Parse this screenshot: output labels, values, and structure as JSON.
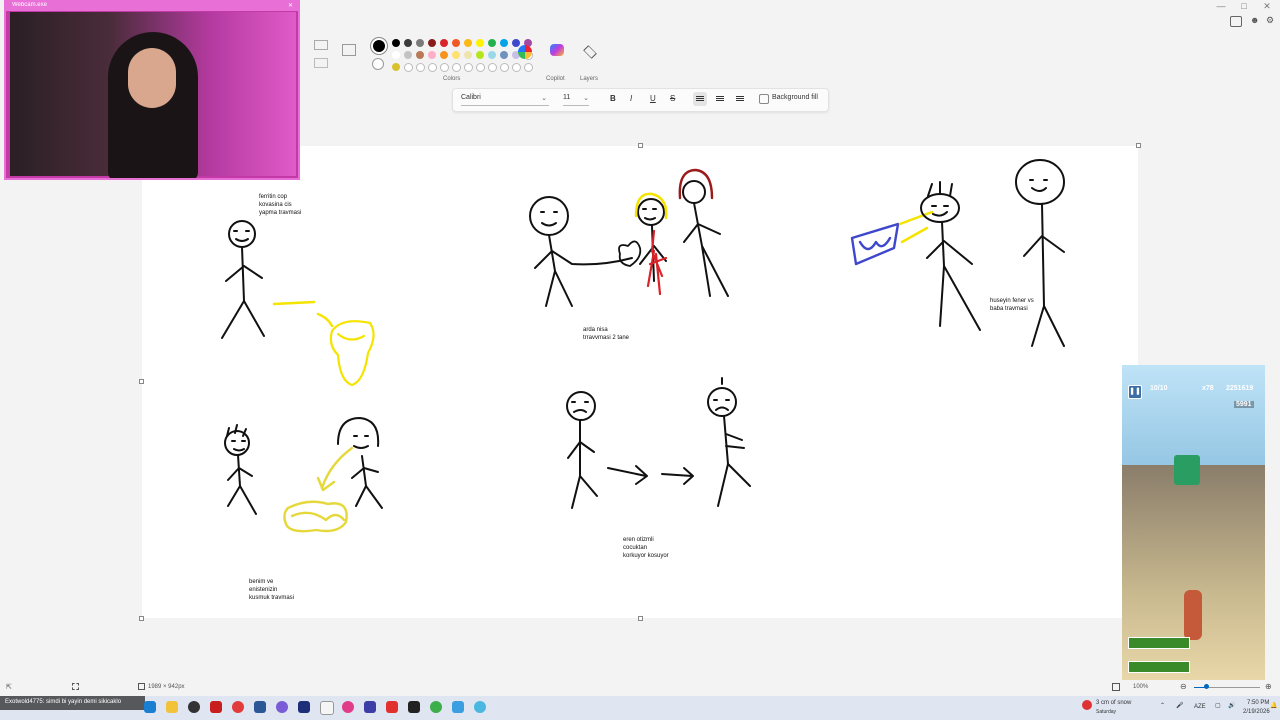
{
  "webcam": {
    "title": "Webcam.exe"
  },
  "ribbon": {
    "colors_label": "Colors",
    "copilot_label": "Copilot",
    "layers_label": "Layers",
    "palette_row1": [
      "#000000",
      "#3b3b3b",
      "#7a7a7a",
      "#8b1c1c",
      "#d8232a",
      "#f15a24",
      "#fdb813",
      "#fff200",
      "#22b14c",
      "#00a2e8",
      "#3f48cc",
      "#a349a4"
    ],
    "palette_row2": [
      "#ffffff",
      "#c3c3c3",
      "#b97a57",
      "#ffaec9",
      "#f7941d",
      "#ffe170",
      "#efe4b0",
      "#b5e61d",
      "#99d9ea",
      "#7092be",
      "#c8bfe7"
    ],
    "palette_row3": [
      "#d9c12e"
    ]
  },
  "text_toolbar": {
    "font_name": "Calibri",
    "font_size": "11",
    "background_fill_label": "Background fill",
    "bold_label": "B",
    "italic_label": "I",
    "underline_label": "U",
    "strike_label": "S"
  },
  "canvas": {
    "captions": {
      "c1": "ferritin cop\nkovasina cis\nyapma travmasi",
      "c2": "arda nisa\ntrravvmasi 2 tane",
      "c3": "huseyin fener vs\nbaba travmasi",
      "c4": "benim ve\nenistenizin\nkusmuk travmasi",
      "c5": "eren otizmli\ncocuktan\nkorkuyor kosuyor"
    }
  },
  "status_bar": {
    "canvas_size": "1989 × 942px",
    "zoom": "100%"
  },
  "game": {
    "keys": "10/10",
    "multiplier": "x78",
    "score": "2251619",
    "coins": "5991"
  },
  "taskbar": {
    "stream_text": "Exotwold4775: simdi bi yayin demi sikicaklo",
    "weather": "3 cm of snow",
    "weather_sub": "Saturday",
    "lang": "AZE",
    "time": "7:50 PM",
    "date": "2/19/2026"
  },
  "colors": {
    "accent": "#0067c0",
    "webcam_border": "#e86fd6",
    "taskbar": "#dfe6f2"
  }
}
